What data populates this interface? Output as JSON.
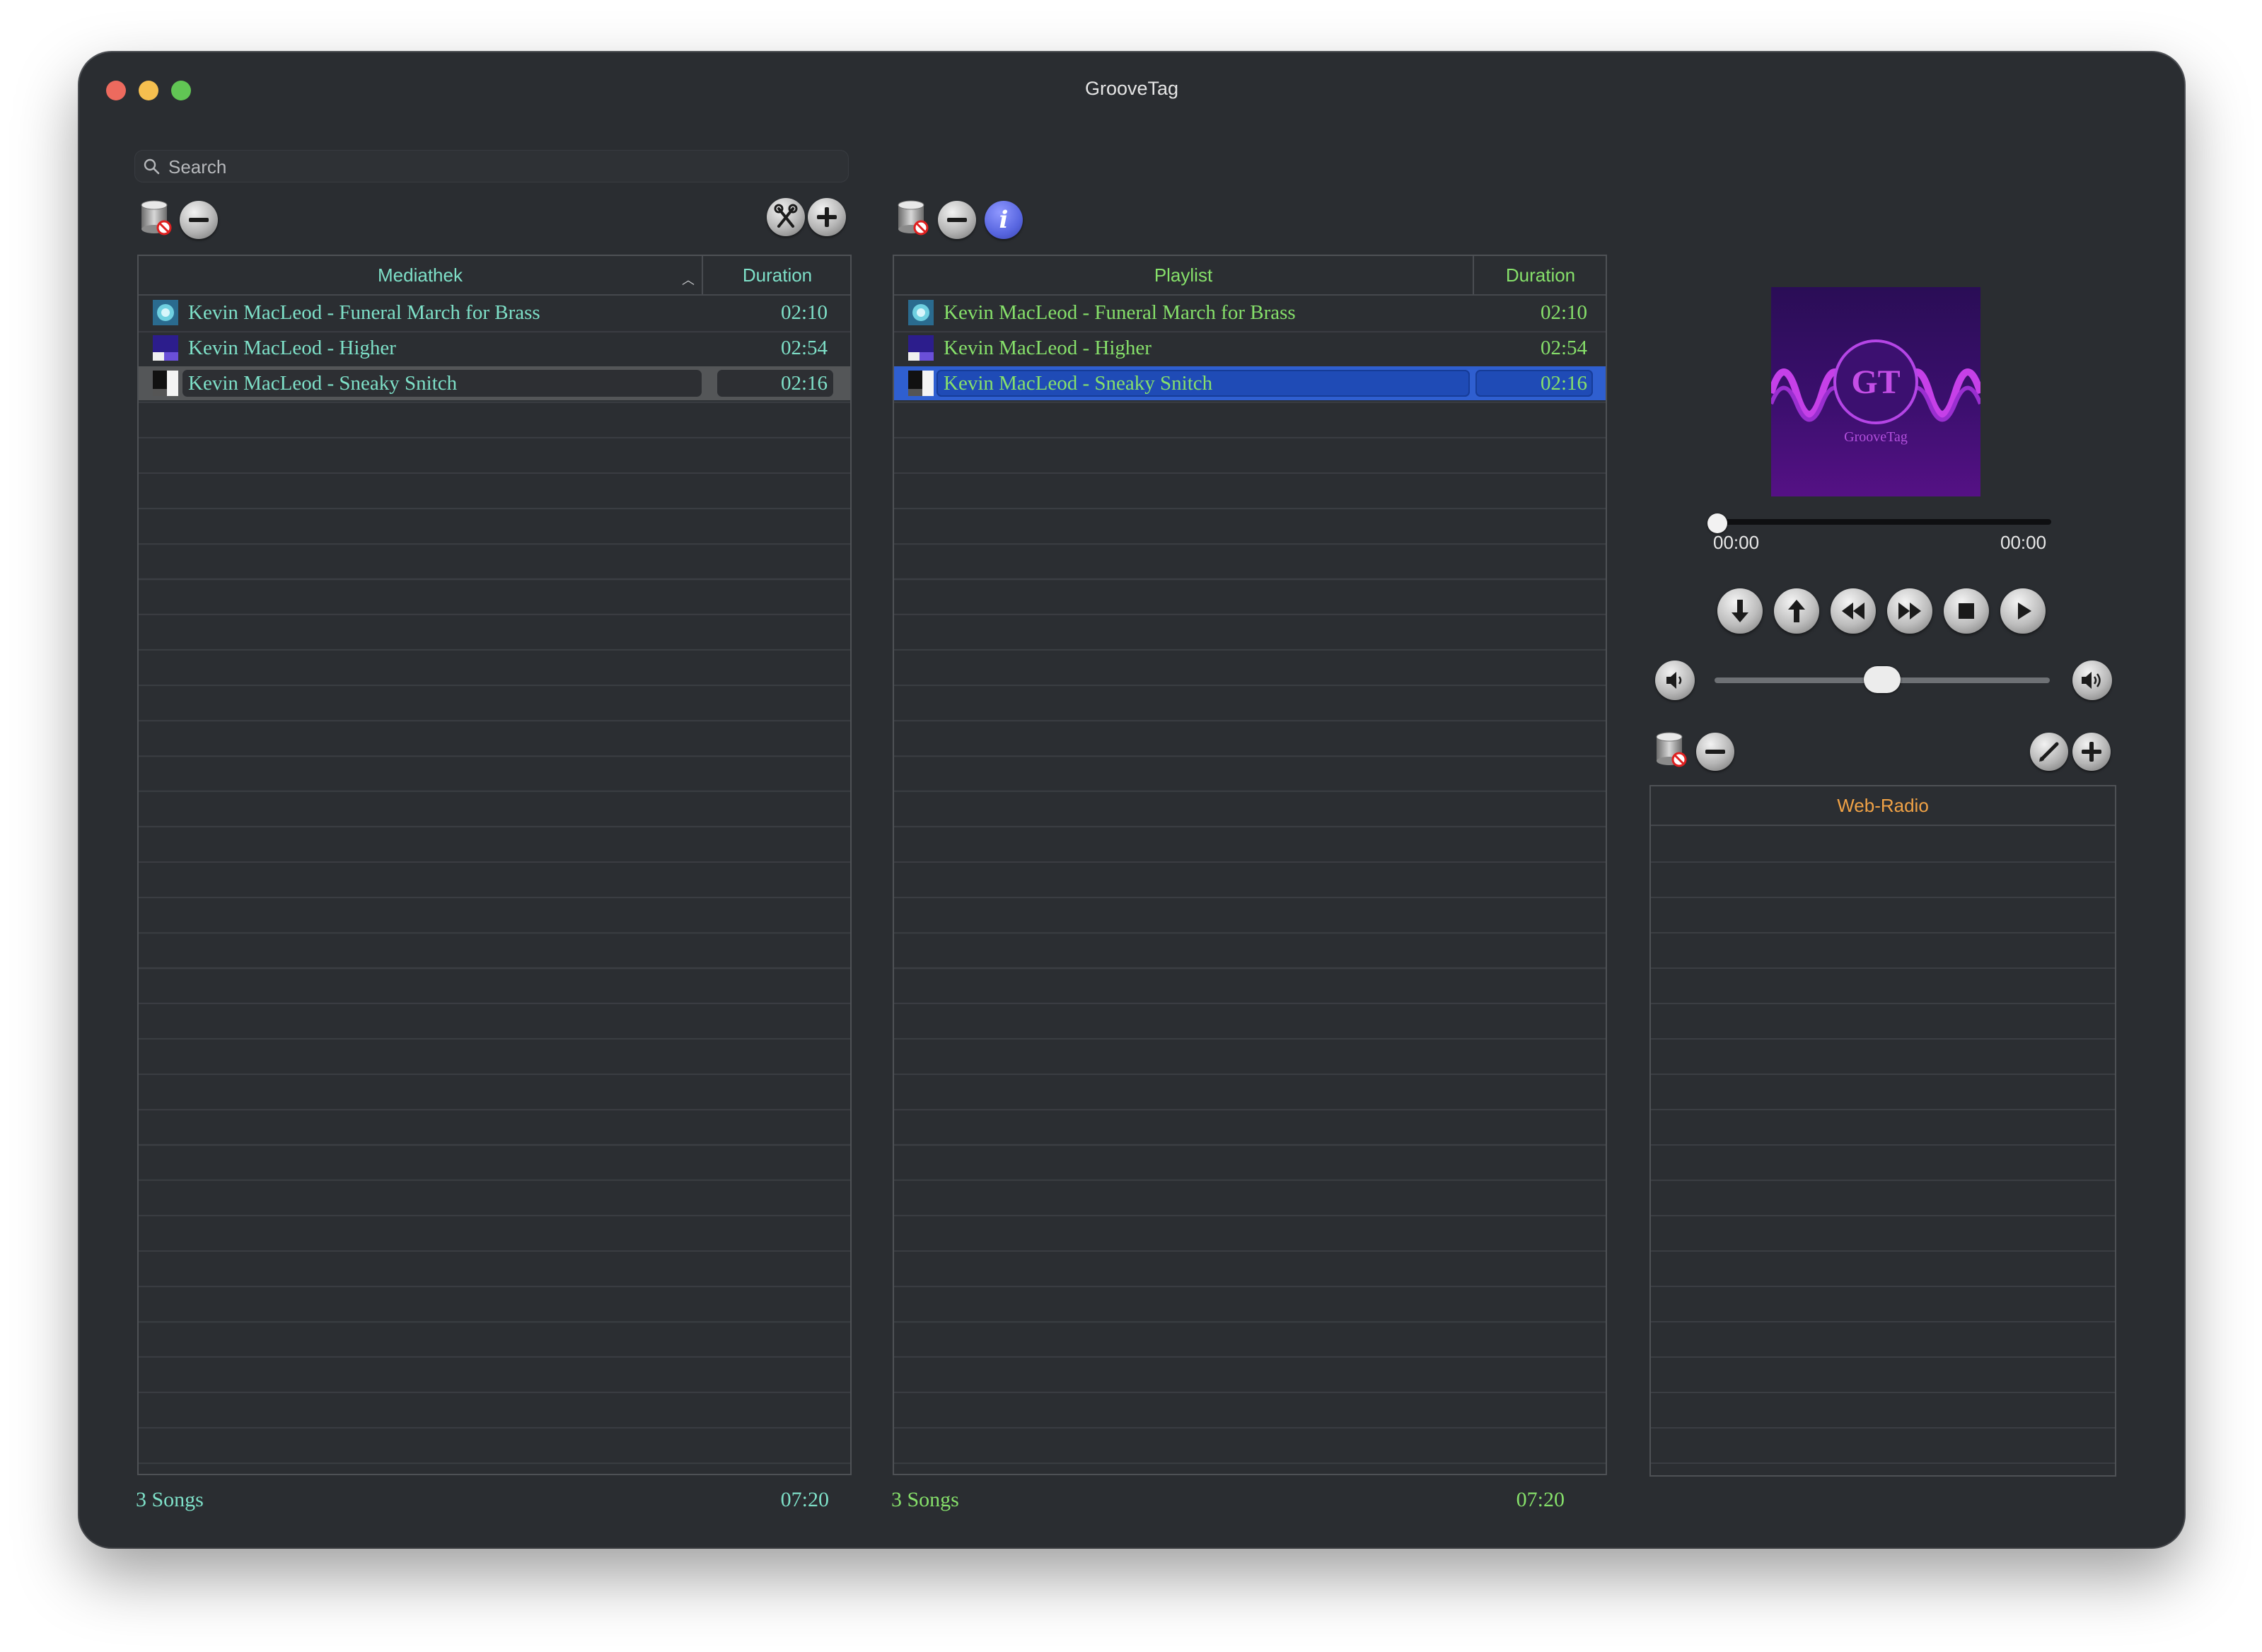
{
  "window": {
    "title": "GrooveTag"
  },
  "search": {
    "placeholder": "Search"
  },
  "library": {
    "header": "Mediathek",
    "duration_header": "Duration",
    "color": "#7ee0c8",
    "rows": [
      {
        "title": "Kevin MacLeod - Funeral March for Brass",
        "duration": "02:10",
        "thumb": "thumb-funeral"
      },
      {
        "title": "Kevin MacLeod - Higher",
        "duration": "02:54",
        "thumb": "thumb-higher"
      },
      {
        "title": "Kevin MacLeod - Sneaky Snitch",
        "duration": "02:16",
        "thumb": "thumb-sneaky"
      }
    ],
    "footer_count": "3 Songs",
    "footer_total": "07:20"
  },
  "playlist": {
    "header": "Playlist",
    "duration_header": "Duration",
    "color": "#86e06a",
    "rows": [
      {
        "title": "Kevin MacLeod - Funeral March for Brass",
        "duration": "02:10",
        "thumb": "thumb-funeral"
      },
      {
        "title": "Kevin MacLeod - Higher",
        "duration": "02:54",
        "thumb": "thumb-higher"
      },
      {
        "title": "Kevin MacLeod - Sneaky Snitch",
        "duration": "02:16",
        "thumb": "thumb-sneaky"
      }
    ],
    "footer_count": "3 Songs",
    "footer_total": "07:20"
  },
  "player": {
    "art_monogram": "GT",
    "art_brand": "GrooveTag",
    "elapsed": "00:00",
    "remaining": "00:00",
    "progress": 0,
    "volume": 0.5
  },
  "webradio": {
    "header": "Web-Radio"
  },
  "colors": {
    "accent_blue": "#2f5fd0",
    "radio_header": "#f0a246",
    "background": "#2a2d31"
  }
}
